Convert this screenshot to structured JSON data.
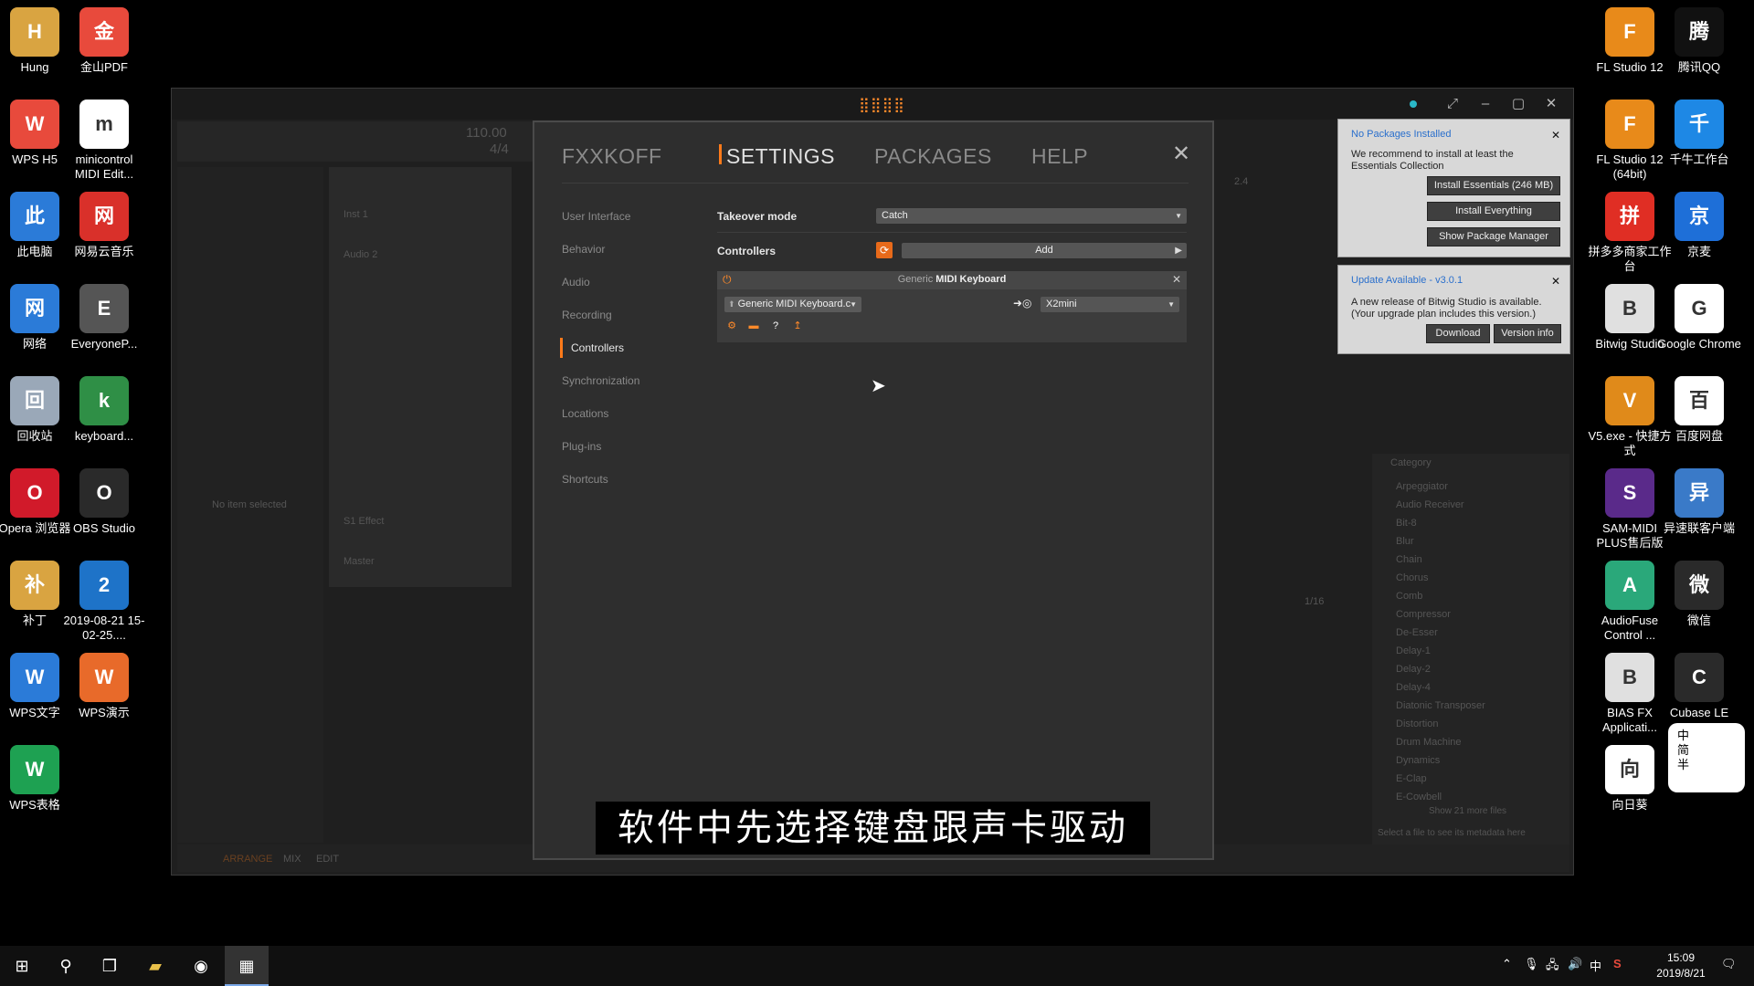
{
  "desktop": {
    "left_icons": [
      {
        "label": "Hung",
        "color": "#d9a441",
        "glyph": "folder-icon"
      },
      {
        "label": "金山PDF",
        "color": "#e84a3c",
        "glyph": "pdf-icon"
      },
      {
        "label": "WPS H5",
        "color": "#e84a3c",
        "glyph": "wps-h5-icon"
      },
      {
        "label": "minicontrol MIDI Edit...",
        "color": "#ffffff",
        "glyph": "keyboard-icon"
      },
      {
        "label": "此电脑",
        "color": "#2b7bd8",
        "glyph": "computer-icon"
      },
      {
        "label": "网易云音乐",
        "color": "#d9302a",
        "glyph": "music-icon"
      },
      {
        "label": "网络",
        "color": "#2b7bd8",
        "glyph": "network-icon"
      },
      {
        "label": "EveryoneP...",
        "color": "#555555",
        "glyph": "piano-icon"
      },
      {
        "label": "回收站",
        "color": "#9aa8b8",
        "glyph": "recycle-bin-icon"
      },
      {
        "label": "keyboard...",
        "color": "#2f8f46",
        "glyph": "test-icon"
      },
      {
        "label": "Opera 浏览器",
        "color": "#d11a2a",
        "glyph": "opera-icon"
      },
      {
        "label": "OBS Studio",
        "color": "#2a2a2a",
        "glyph": "obs-icon"
      },
      {
        "label": "补丁",
        "color": "#d9a441",
        "glyph": "folder-icon"
      },
      {
        "label": "2019-08-21 15-02-25....",
        "color": "#1e73c8",
        "glyph": "video-file-icon"
      },
      {
        "label": "WPS文字",
        "color": "#2b7bd8",
        "glyph": "wps-writer-icon"
      },
      {
        "label": "WPS演示",
        "color": "#e86a2a",
        "glyph": "wps-presentation-icon"
      },
      {
        "label": "WPS表格",
        "color": "#1ea152",
        "glyph": "wps-spreadsheet-icon"
      }
    ],
    "right_icons": [
      {
        "label": "FL Studio 12",
        "color": "#e88a1a",
        "glyph": "fl-studio-icon"
      },
      {
        "label": "腾讯QQ",
        "color": "#111111",
        "glyph": "qq-icon"
      },
      {
        "label": "FL Studio 12 (64bit)",
        "color": "#e88a1a",
        "glyph": "fl-studio-icon"
      },
      {
        "label": "千牛工作台",
        "color": "#1e88e5",
        "glyph": "qianniu-icon"
      },
      {
        "label": "拼多多商家工作台",
        "color": "#e02e24",
        "glyph": "pinduoduo-icon"
      },
      {
        "label": "京麦",
        "color": "#1e6fd8",
        "glyph": "jingmai-icon"
      },
      {
        "label": "Bitwig Studio",
        "color": "#e0e0e0",
        "glyph": "bitwig-icon"
      },
      {
        "label": "Google Chrome",
        "color": "#ffffff",
        "glyph": "chrome-icon"
      },
      {
        "label": "V5.exe - 快捷方式",
        "color": "#e08a1a",
        "glyph": "v5-icon"
      },
      {
        "label": "百度网盘",
        "color": "#ffffff",
        "glyph": "baidu-netdisk-icon"
      },
      {
        "label": "SAM-MIDI PLUS售后版",
        "color": "#5a2a8a",
        "glyph": "midi-icon"
      },
      {
        "label": "异速联客户端",
        "color": "#3a7ac8",
        "glyph": "remote-desktop-icon"
      },
      {
        "label": "AudioFuse Control ...",
        "color": "#2aa87a",
        "glyph": "audiofuse-icon"
      },
      {
        "label": "微信",
        "color": "#2a2a2a",
        "glyph": "wechat-icon"
      },
      {
        "label": "BIAS FX Applicati...",
        "color": "#e0e0e0",
        "glyph": "bias-fx-icon"
      },
      {
        "label": "Cubase LE",
        "color": "#2a2a2a",
        "glyph": "cubase-icon"
      },
      {
        "label": "向日葵",
        "color": "#ffffff",
        "glyph": "sunflower-icon"
      }
    ],
    "ime_widget": "中\n简\n半"
  },
  "bitwig": {
    "logo": "⣿⣿⣿⣿",
    "accent": "#ff7a1a",
    "bg_texts": {
      "tempo": "110.00",
      "sig": "4/4",
      "no_item": "No item selected",
      "bar": "2.4",
      "inst1": "Inst 1",
      "audio2": "Audio 2",
      "s1effect": "S1 Effect",
      "master": "Master",
      "category": "Category",
      "grid": "1/16",
      "footer_tabs": [
        "ARRANGE",
        "MIX",
        "EDIT"
      ],
      "browser_items": [
        "Arpeggiator",
        "Audio Receiver",
        "Bit-8",
        "Blur",
        "Chain",
        "Chorus",
        "Comb",
        "Compressor",
        "De-Esser",
        "Delay-1",
        "Delay-2",
        "Delay-4",
        "Diatonic Transposer",
        "Distortion",
        "Drum Machine",
        "Dynamics",
        "E-Clap",
        "E-Cowbell"
      ],
      "browser_footer": "Select a file to see its metadata here",
      "browser_more": "Show 21 more files"
    },
    "settings": {
      "tabs": [
        "FXXKOFF",
        "SETTINGS",
        "PACKAGES",
        "HELP"
      ],
      "active_tab": "SETTINGS",
      "close": "✕",
      "nav": [
        "User Interface",
        "Behavior",
        "Audio",
        "Recording",
        "Controllers",
        "Synchronization",
        "Locations",
        "Plug-ins",
        "Shortcuts"
      ],
      "active_nav": "Controllers",
      "takeover_label": "Takeover mode",
      "takeover_value": "Catch",
      "controllers_label": "Controllers",
      "add_label": "Add",
      "controller": {
        "title_prefix": "Generic",
        "title_main": "MIDI Keyboard",
        "input_value": "Generic MIDI Keyboard.c",
        "output_value": "X2mini"
      }
    }
  },
  "notifications": {
    "packages": {
      "title": "No Packages Installed",
      "text": "We recommend to install at least the Essentials Collection",
      "btn1": "Install Essentials (246 MB)",
      "btn2": "Install Everything",
      "btn3": "Show Package Manager"
    },
    "update": {
      "title": "Update Available - v3.0.1",
      "text": "A new release of Bitwig Studio is available. (Your upgrade plan includes this version.)",
      "btn1": "Download",
      "btn2": "Version info"
    }
  },
  "subtitle": "软件中先选择键盘跟声卡驱动",
  "taskbar": {
    "time": "15:09",
    "date": "2019/8/21",
    "ime": "中"
  }
}
